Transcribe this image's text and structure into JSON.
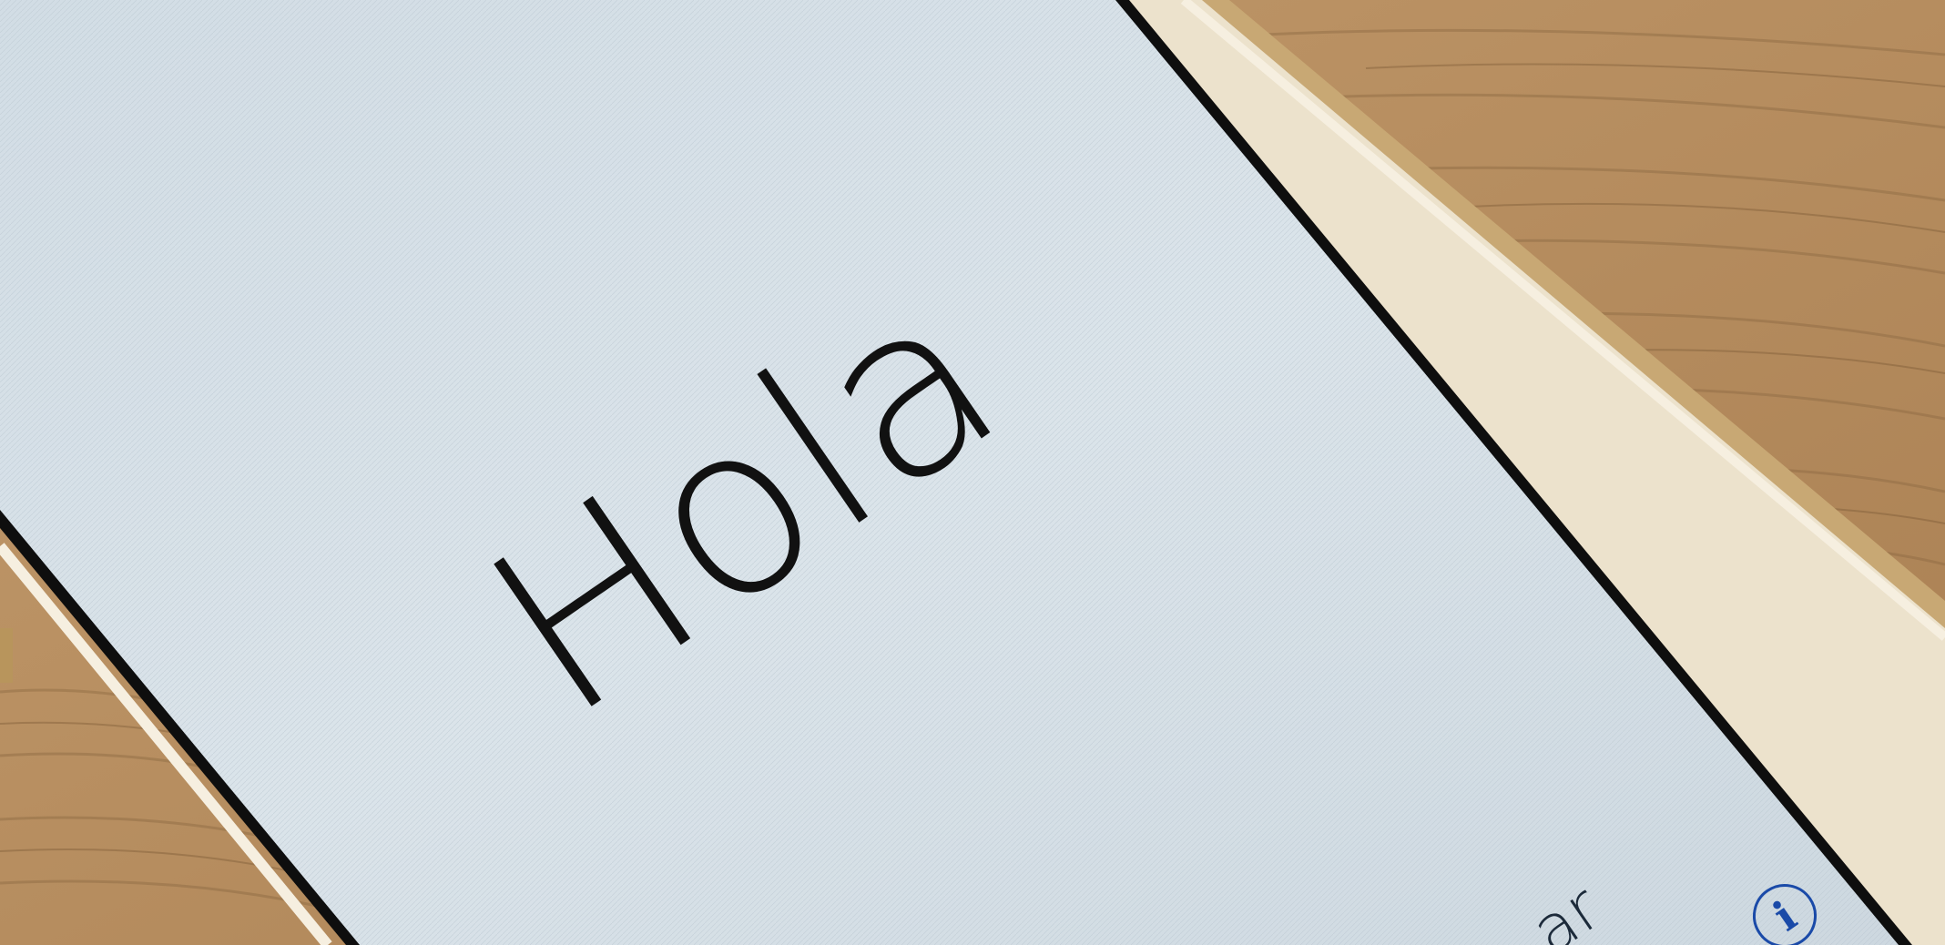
{
  "screen": {
    "greeting": "Hola",
    "partial_link": "ar",
    "info_icon": "info-icon"
  },
  "colors": {
    "wood": "#b99164",
    "screen": "#d9e2e8",
    "bezel": "#e8dcc4",
    "gold_frame": "#c9ad7a",
    "text": "#111111",
    "info_blue": "#1a4aa8"
  }
}
